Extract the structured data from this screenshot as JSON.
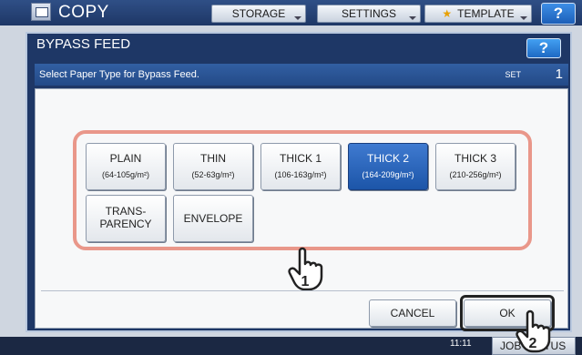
{
  "app": {
    "title": "COPY",
    "tabs": [
      "STORAGE",
      "SETTINGS",
      "TEMPLATE"
    ],
    "help_label": "?",
    "clock": "11:11",
    "job_status_label": "JOB STATUS"
  },
  "dialog": {
    "title": "BYPASS FEED",
    "help_label": "?",
    "instruction": "Select Paper Type for Bypass Feed.",
    "set_label": "SET",
    "set_value": "1",
    "paper_types": [
      {
        "name": "PLAIN",
        "weight": "(64-105g/m²)"
      },
      {
        "name": "THIN",
        "weight": "(52-63g/m²)"
      },
      {
        "name": "THICK 1",
        "weight": "(106-163g/m²)"
      },
      {
        "name": "THICK 2",
        "weight": "(164-209g/m²)",
        "selected": true
      },
      {
        "name": "THICK 3",
        "weight": "(210-256g/m²)"
      },
      {
        "name": "TRANS-\nPARENCY"
      },
      {
        "name": "ENVELOPE"
      }
    ],
    "cancel_label": "CANCEL",
    "ok_label": "OK",
    "step_markers": [
      "1",
      "2"
    ]
  },
  "colors": {
    "dialog_bg": "#1e3766",
    "selected_button": "#2a66bf",
    "highlight_frame": "#e9978a"
  }
}
